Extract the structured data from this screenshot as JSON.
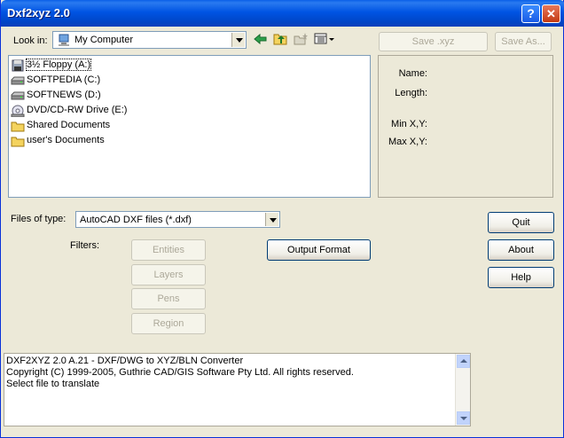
{
  "window": {
    "title": "Dxf2xyz 2.0"
  },
  "title_buttons": {
    "help": "?",
    "close": "✕"
  },
  "look_in": {
    "label": "Look in:",
    "value": "My Computer"
  },
  "top_buttons": {
    "save_xyz": "Save .xyz",
    "save_as": "Save As..."
  },
  "drives": [
    {
      "label": "3½ Floppy (A:)",
      "icon": "floppy-icon"
    },
    {
      "label": "SOFTPEDIA (C:)",
      "icon": "hard-drive-icon"
    },
    {
      "label": "SOFTNEWS (D:)",
      "icon": "hard-drive-icon"
    },
    {
      "label": "DVD/CD-RW Drive (E:)",
      "icon": "cd-drive-icon"
    },
    {
      "label": "Shared Documents",
      "icon": "folder-icon"
    },
    {
      "label": "user's Documents",
      "icon": "folder-icon"
    }
  ],
  "info": {
    "name": "Name:",
    "length": "Length:",
    "min": "Min X,Y:",
    "max": "Max X,Y:"
  },
  "file_type": {
    "label": "Files of type:",
    "value": "AutoCAD DXF files (*.dxf)"
  },
  "filters": {
    "label": "Filters:",
    "entities": "Entities",
    "layers": "Layers",
    "pens": "Pens",
    "region": "Region"
  },
  "output_format": "Output Format",
  "actions": {
    "quit": "Quit",
    "about": "About",
    "help": "Help"
  },
  "log": [
    "DXF2XYZ 2.0 A.21  -  DXF/DWG to XYZ/BLN Converter",
    "Copyright (C) 1999-2005, Guthrie CAD/GIS Software Pty Ltd.  All rights reserved.",
    "Select file to translate"
  ],
  "colors": {
    "titlebar": "#0054E3",
    "face": "#ECE9D8",
    "border": "#7F9DB9"
  }
}
